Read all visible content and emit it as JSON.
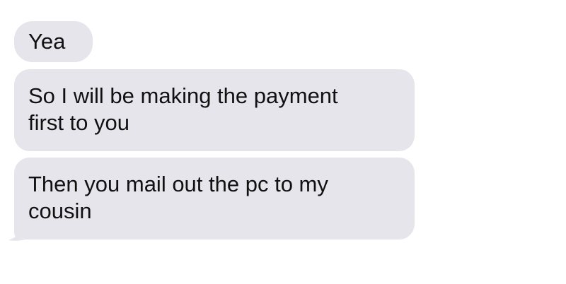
{
  "conversation": {
    "messages": [
      {
        "lines": [
          "Yea"
        ]
      },
      {
        "lines": [
          "So I will be making the payment",
          "first to you"
        ]
      },
      {
        "lines": [
          "Then you mail out the pc to my",
          "cousin"
        ]
      }
    ]
  },
  "colors": {
    "incoming_bubble": "#e6e5eb",
    "text": "#111111",
    "background": "#ffffff"
  }
}
